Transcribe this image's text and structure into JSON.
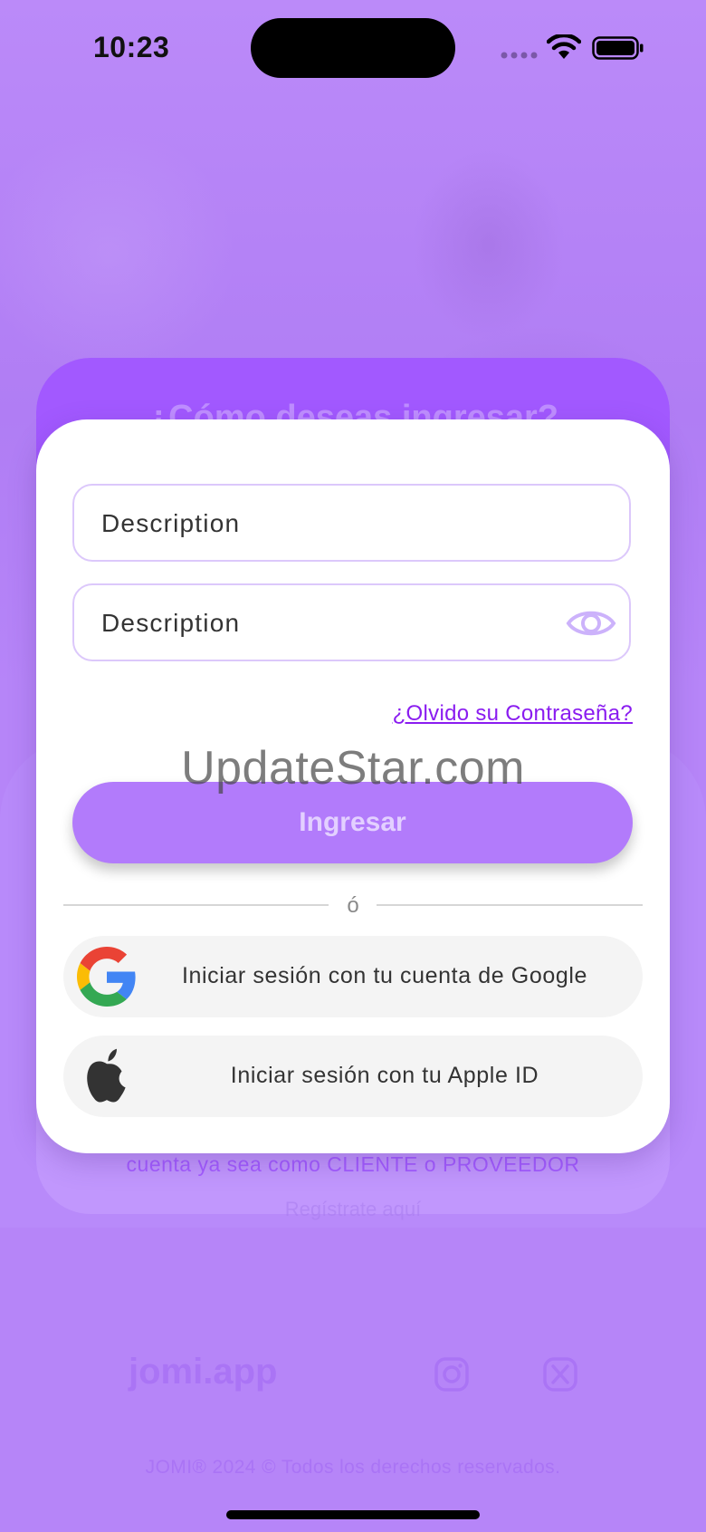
{
  "status_bar": {
    "time": "10:23"
  },
  "background": {
    "heading": "¿Cómo deseas ingresar?",
    "subtext": "cuenta ya sea como CLIENTE o PROVEEDOR",
    "register_text": "Regístrate aquí"
  },
  "login": {
    "username_placeholder": "Description",
    "password_placeholder": "Description",
    "forgot_link": "¿Olvido su Contraseña?",
    "submit_label": "Ingresar",
    "divider_text": "ó",
    "google_label": "Iniciar sesión con tu cuenta de Google",
    "apple_label": "Iniciar sesión con tu Apple ID"
  },
  "watermark": "UpdateStar.com",
  "footer": {
    "logo": "jomi.app",
    "copyright": "JOMI® 2024 © Todos los derechos reservados."
  },
  "icons": {
    "eye": "eye-icon",
    "google": "google-icon",
    "apple": "apple-icon",
    "instagram": "instagram-icon",
    "x": "x-icon"
  },
  "colors": {
    "accent": "#a259ff",
    "link": "#8a1cf0",
    "background": "#b685f8"
  }
}
